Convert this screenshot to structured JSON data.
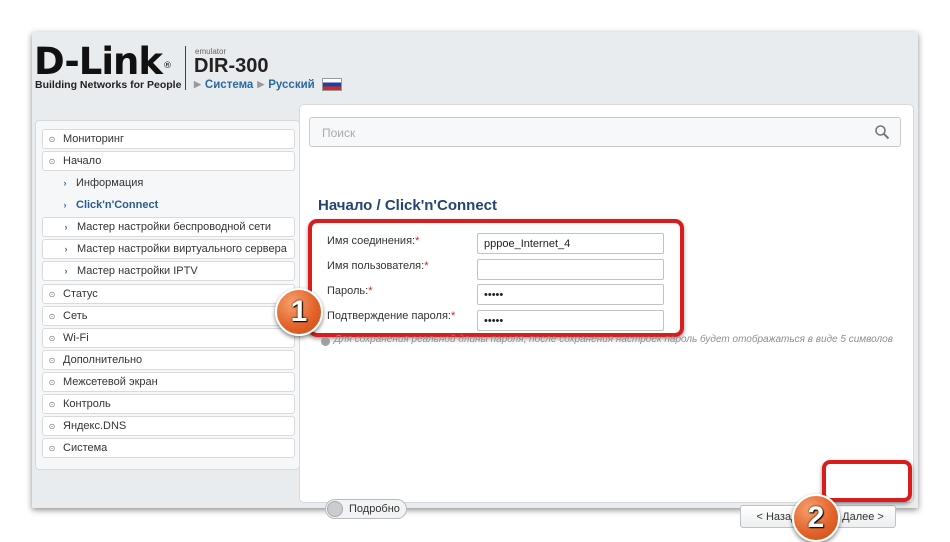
{
  "header": {
    "logo": "D-Link",
    "tagline": "Building Networks for People",
    "emulator_label": "emulator",
    "model": "DIR-300",
    "breadcrumb_system": "Система",
    "breadcrumb_language": "Русский"
  },
  "sidebar": {
    "items": [
      {
        "label": "Мониторинг"
      },
      {
        "label": "Начало"
      },
      {
        "label": "Информация"
      },
      {
        "label": "Click'n'Connect"
      },
      {
        "label": "Мастер настройки беспроводной сети"
      },
      {
        "label": "Мастер настройки виртуального сервера"
      },
      {
        "label": "Мастер настройки IPTV"
      },
      {
        "label": "Статус"
      },
      {
        "label": "Сеть"
      },
      {
        "label": "Wi-Fi"
      },
      {
        "label": "Дополнительно"
      },
      {
        "label": "Межсетевой экран"
      },
      {
        "label": "Контроль"
      },
      {
        "label": "Яндекс.DNS"
      },
      {
        "label": "Система"
      }
    ]
  },
  "search": {
    "placeholder": "Поиск"
  },
  "main": {
    "title": "Начало /  Click'n'Connect",
    "fields": [
      {
        "label": "Имя соединения:",
        "value": "pppoe_Internet_4"
      },
      {
        "label": "Имя пользователя:",
        "value": ""
      },
      {
        "label": "Пароль:",
        "value": "•••••"
      },
      {
        "label": "Подтверждение пароля:",
        "value": "•••••"
      }
    ],
    "required_mark": "*",
    "hint": "Для сохранения реальной длины пароля, после сохранения настроек пароль будет отображаться в виде 5 символов",
    "details_toggle": "Подробно",
    "back_button": "< Назад",
    "next_button": "Далее >"
  },
  "annotations": {
    "badge1": "1",
    "badge2": "2"
  },
  "colors": {
    "accent_red": "#d91d1d",
    "title_blue": "#23456e",
    "badge_orange": "#e3642b"
  }
}
